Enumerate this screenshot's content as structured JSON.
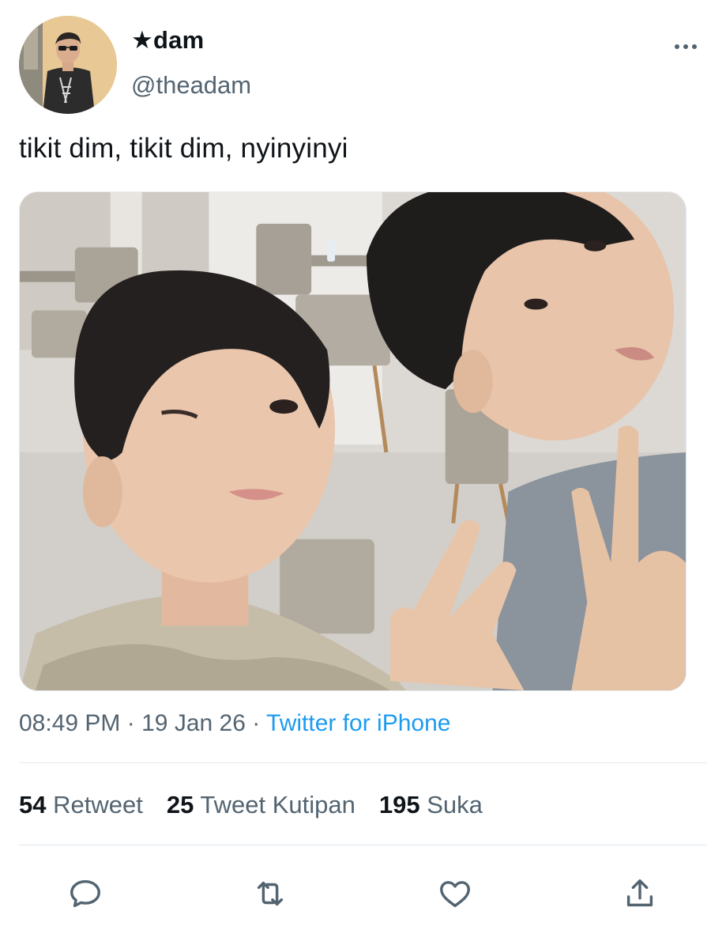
{
  "tweet": {
    "display_name": "★dam",
    "username": "@theadam",
    "text": "tikit dim, tikit dim, nyinyinyi",
    "time": "08:49 PM",
    "date": "19 Jan 26",
    "separator": "·",
    "source": "Twitter for iPhone"
  },
  "stats": {
    "retweets_count": "54",
    "retweets_label": "Retweet",
    "quotes_count": "25",
    "quotes_label": "Tweet Kutipan",
    "likes_count": "195",
    "likes_label": "Suka"
  },
  "icons": {
    "reply": "reply-icon",
    "retweet": "retweet-icon",
    "like": "heart-icon",
    "share": "share-icon",
    "more": "more-icon"
  },
  "colors": {
    "text_primary": "#0f1419",
    "text_secondary": "#536471",
    "link": "#1d9bf0",
    "divider": "#e1e8ed"
  }
}
